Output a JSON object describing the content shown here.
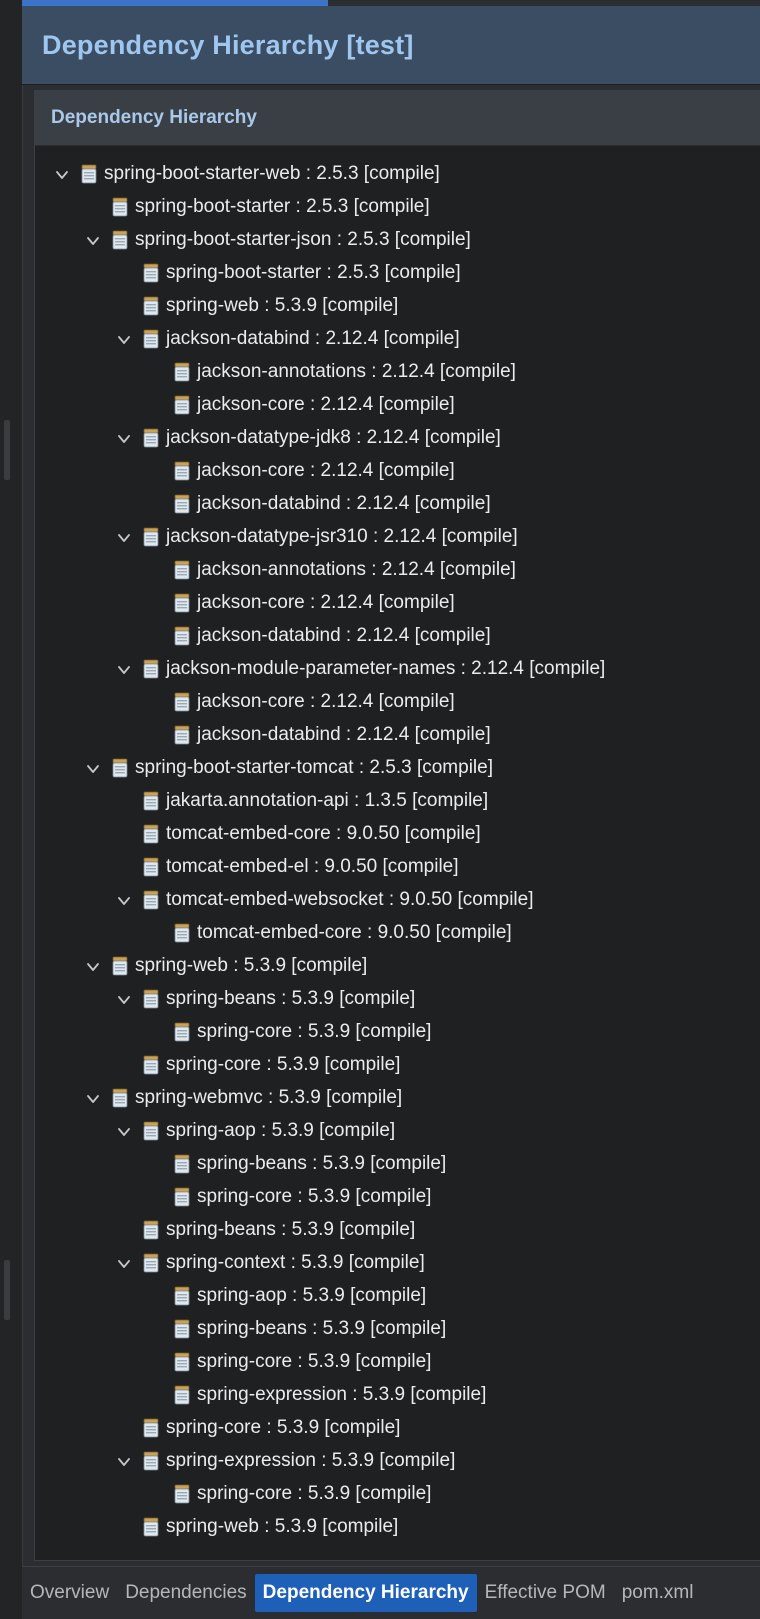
{
  "editor": {
    "title": "Dependency Hierarchy [test]"
  },
  "section": {
    "title": "Dependency Hierarchy"
  },
  "tree": [
    {
      "label": "spring-boot-starter-web : 2.5.3 [compile]",
      "depth": 0,
      "expanded": true
    },
    {
      "label": "spring-boot-starter : 2.5.3 [compile]",
      "depth": 1,
      "expanded": false
    },
    {
      "label": "spring-boot-starter-json : 2.5.3 [compile]",
      "depth": 1,
      "expanded": true
    },
    {
      "label": "spring-boot-starter : 2.5.3 [compile]",
      "depth": 2,
      "expanded": false
    },
    {
      "label": "spring-web : 5.3.9 [compile]",
      "depth": 2,
      "expanded": false
    },
    {
      "label": "jackson-databind : 2.12.4 [compile]",
      "depth": 2,
      "expanded": true
    },
    {
      "label": "jackson-annotations : 2.12.4 [compile]",
      "depth": 3,
      "expanded": false
    },
    {
      "label": "jackson-core : 2.12.4 [compile]",
      "depth": 3,
      "expanded": false
    },
    {
      "label": "jackson-datatype-jdk8 : 2.12.4 [compile]",
      "depth": 2,
      "expanded": true
    },
    {
      "label": "jackson-core : 2.12.4 [compile]",
      "depth": 3,
      "expanded": false
    },
    {
      "label": "jackson-databind : 2.12.4 [compile]",
      "depth": 3,
      "expanded": false
    },
    {
      "label": "jackson-datatype-jsr310 : 2.12.4 [compile]",
      "depth": 2,
      "expanded": true
    },
    {
      "label": "jackson-annotations : 2.12.4 [compile]",
      "depth": 3,
      "expanded": false
    },
    {
      "label": "jackson-core : 2.12.4 [compile]",
      "depth": 3,
      "expanded": false
    },
    {
      "label": "jackson-databind : 2.12.4 [compile]",
      "depth": 3,
      "expanded": false
    },
    {
      "label": "jackson-module-parameter-names : 2.12.4 [compile]",
      "depth": 2,
      "expanded": true
    },
    {
      "label": "jackson-core : 2.12.4 [compile]",
      "depth": 3,
      "expanded": false
    },
    {
      "label": "jackson-databind : 2.12.4 [compile]",
      "depth": 3,
      "expanded": false
    },
    {
      "label": "spring-boot-starter-tomcat : 2.5.3 [compile]",
      "depth": 1,
      "expanded": true
    },
    {
      "label": "jakarta.annotation-api : 1.3.5 [compile]",
      "depth": 2,
      "expanded": false
    },
    {
      "label": "tomcat-embed-core : 9.0.50 [compile]",
      "depth": 2,
      "expanded": false
    },
    {
      "label": "tomcat-embed-el : 9.0.50 [compile]",
      "depth": 2,
      "expanded": false
    },
    {
      "label": "tomcat-embed-websocket : 9.0.50 [compile]",
      "depth": 2,
      "expanded": true
    },
    {
      "label": "tomcat-embed-core : 9.0.50 [compile]",
      "depth": 3,
      "expanded": false
    },
    {
      "label": "spring-web : 5.3.9 [compile]",
      "depth": 1,
      "expanded": true
    },
    {
      "label": "spring-beans : 5.3.9 [compile]",
      "depth": 2,
      "expanded": true
    },
    {
      "label": "spring-core : 5.3.9 [compile]",
      "depth": 3,
      "expanded": false
    },
    {
      "label": "spring-core : 5.3.9 [compile]",
      "depth": 2,
      "expanded": false
    },
    {
      "label": "spring-webmvc : 5.3.9 [compile]",
      "depth": 1,
      "expanded": true
    },
    {
      "label": "spring-aop : 5.3.9 [compile]",
      "depth": 2,
      "expanded": true
    },
    {
      "label": "spring-beans : 5.3.9 [compile]",
      "depth": 3,
      "expanded": false
    },
    {
      "label": "spring-core : 5.3.9 [compile]",
      "depth": 3,
      "expanded": false
    },
    {
      "label": "spring-beans : 5.3.9 [compile]",
      "depth": 2,
      "expanded": false
    },
    {
      "label": "spring-context : 5.3.9 [compile]",
      "depth": 2,
      "expanded": true
    },
    {
      "label": "spring-aop : 5.3.9 [compile]",
      "depth": 3,
      "expanded": false
    },
    {
      "label": "spring-beans : 5.3.9 [compile]",
      "depth": 3,
      "expanded": false
    },
    {
      "label": "spring-core : 5.3.9 [compile]",
      "depth": 3,
      "expanded": false
    },
    {
      "label": "spring-expression : 5.3.9 [compile]",
      "depth": 3,
      "expanded": false
    },
    {
      "label": "spring-core : 5.3.9 [compile]",
      "depth": 2,
      "expanded": false
    },
    {
      "label": "spring-expression : 5.3.9 [compile]",
      "depth": 2,
      "expanded": true
    },
    {
      "label": "spring-core : 5.3.9 [compile]",
      "depth": 3,
      "expanded": false
    },
    {
      "label": "spring-web : 5.3.9 [compile]",
      "depth": 2,
      "expanded": false
    }
  ],
  "bottom_tabs": [
    {
      "label": "Overview",
      "active": false
    },
    {
      "label": "Dependencies",
      "active": false
    },
    {
      "label": "Dependency Hierarchy",
      "active": true
    },
    {
      "label": "Effective POM",
      "active": false
    },
    {
      "label": "pom.xml",
      "active": false
    }
  ],
  "colors": {
    "accent": "#3b74c6",
    "title_text": "#9fc6ee",
    "active_tab": "#1e5fb8"
  },
  "icons": {
    "expand": "chevron-down-icon",
    "artifact": "jar-icon"
  }
}
